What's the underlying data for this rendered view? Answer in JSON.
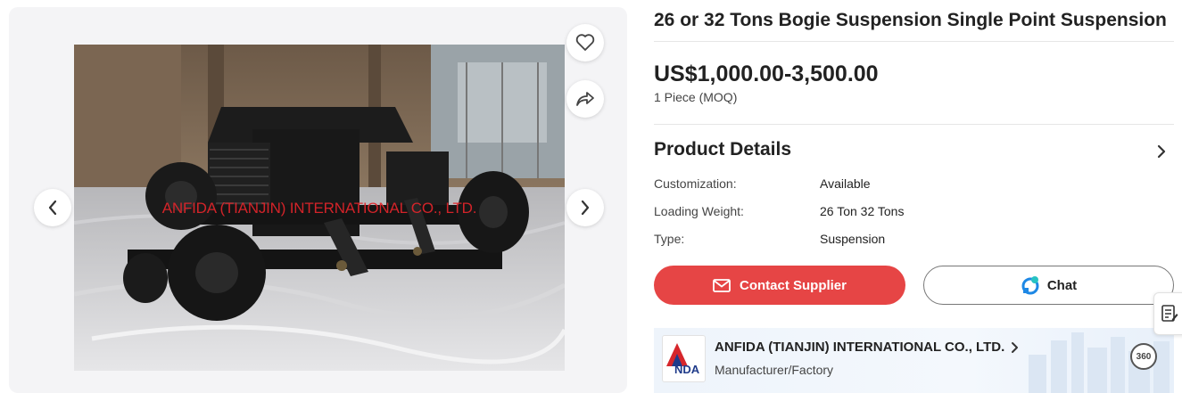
{
  "product": {
    "title": "26 or 32 Tons Bogie Suspension Single Point Suspension",
    "price": "US$1,000.00-3,500.00",
    "moq": "1 Piece (MOQ)"
  },
  "gallery": {
    "watermark": "ANFIDA (TIANJIN) INTERNATIONAL CO., LTD.",
    "icons": [
      "heart-icon",
      "share-icon",
      "chevron-left-icon",
      "chevron-right-icon"
    ]
  },
  "details": {
    "title": "Product Details",
    "attributes": [
      {
        "label": "Customization:",
        "value": "Available"
      },
      {
        "label": "Loading Weight:",
        "value": "26 Ton 32 Tons"
      },
      {
        "label": "Type:",
        "value": "Suspension"
      }
    ]
  },
  "actions": {
    "contact_label": "Contact Supplier",
    "chat_label": "Chat"
  },
  "supplier": {
    "name": "ANFIDA (TIANJIN) INTERNATIONAL CO., LTD.",
    "type": "Manufacturer/Factory",
    "logo_text": "NDA",
    "vr_label": "360"
  },
  "colors": {
    "accent": "#e64545",
    "chat_blue": "#1e88e5",
    "watermark": "#e3252b"
  }
}
